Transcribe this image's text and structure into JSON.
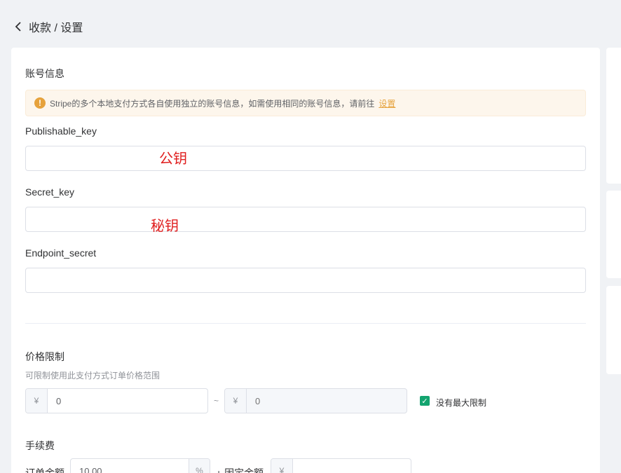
{
  "header": {
    "breadcrumb": "收款 / 设置"
  },
  "account": {
    "title": "账号信息",
    "alert_text": "Stripe的多个本地支付方式各自使用独立的账号信息，如需使用相同的账号信息，请前往",
    "alert_link": "设置",
    "fields": [
      {
        "label": "Publishable_key",
        "value": "",
        "note": "公钥"
      },
      {
        "label": "Secret_key",
        "value": "",
        "note": "秘钥"
      },
      {
        "label": "Endpoint_secret",
        "value": ""
      }
    ]
  },
  "price_limit": {
    "title": "价格限制",
    "hint": "可限制使用此支付方式订单价格范围",
    "currency": "¥",
    "min_value": "0",
    "separator": "~",
    "max_placeholder": "0",
    "no_max_label": "没有最大限制",
    "no_max_checked": true
  },
  "fee": {
    "title": "手续费",
    "order_amount_label": "订单金额",
    "percent_value": "10.00",
    "percent_unit": "%",
    "plus_fixed_label": "+ 固定金额",
    "currency": "¥",
    "fixed_value": ""
  },
  "colors": {
    "accent": "#13a46f",
    "warning": "#e6a23c",
    "note_red": "#e02020"
  }
}
